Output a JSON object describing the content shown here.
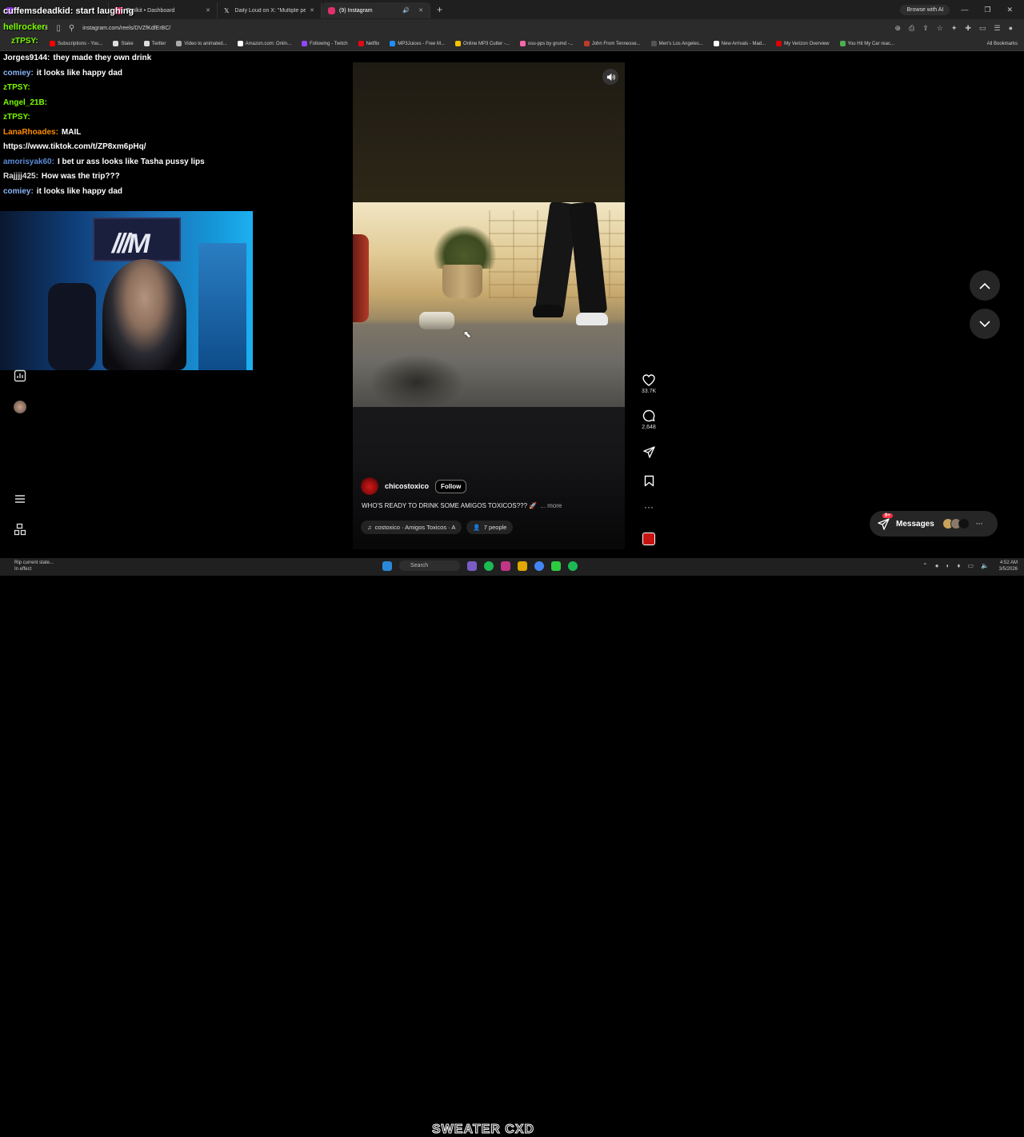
{
  "browser": {
    "tabs": [
      {
        "title": "",
        "active": false,
        "color": "#8a2be2"
      },
      {
        "title": "Toolkit • Dashboard",
        "active": false,
        "color": "#e91e63"
      },
      {
        "title": "Daily Loud on X: \"Multiple peo",
        "active": false,
        "color": "#ffffff"
      },
      {
        "title": "(9) Instagram",
        "active": true,
        "color": "#e1306c"
      }
    ],
    "browse_ai": "Browse with AI",
    "url": "instagram.com/reels/DVZfKdfErBC/",
    "bookmarks": [
      {
        "label": "Subscriptions - You...",
        "color": "#ff0000"
      },
      {
        "label": "Stake",
        "color": "#dddddd"
      },
      {
        "label": "Twitter",
        "color": "#dddddd"
      },
      {
        "label": "Video to animated...",
        "color": "#aaaaaa"
      },
      {
        "label": "Amazon.com: Onlin...",
        "color": "#ffffff"
      },
      {
        "label": "Following - Twitch",
        "color": "#9146ff"
      },
      {
        "label": "Netflix",
        "color": "#e50914"
      },
      {
        "label": "MP3Juices - Free M...",
        "color": "#1e90ff"
      },
      {
        "label": "Online MP3 Cutter -...",
        "color": "#f5c400"
      },
      {
        "label": "osu-pps by grumd -...",
        "color": "#ff66aa"
      },
      {
        "label": "John From Tennesse...",
        "color": "#c0392b"
      },
      {
        "label": "Men's Los Angeles...",
        "color": "#555555"
      },
      {
        "label": "New Arrivals - Mad...",
        "color": "#ffffff"
      },
      {
        "label": "My Verizon Overview",
        "color": "#e00000"
      },
      {
        "label": "You Hit My Car reac...",
        "color": "#4caf50"
      }
    ],
    "all_bookmarks": "All Bookmarks"
  },
  "chat": {
    "overlay_top": {
      "user": "cuffemsdeadkid:",
      "text": "start laughing",
      "user_color": "#ffffff"
    },
    "overlay_second": {
      "user": "hellrocker:",
      "text": "",
      "user_color": "#7CFC00"
    },
    "overlay_third": {
      "user": "zTPSY:",
      "text": "",
      "user_color": "#7CFC00"
    },
    "messages": [
      {
        "user": "Jorges9144:",
        "text": "they made they own drink",
        "user_color": "#ffffff"
      },
      {
        "user": "comiey:",
        "text": "it looks like happy dad",
        "user_color": "#8ab4f8"
      },
      {
        "user": "zTPSY:",
        "text": "",
        "user_color": "#7CFC00"
      },
      {
        "user": "Angel_21B:",
        "text": "",
        "user_color": "#7CFC00"
      },
      {
        "user": "zTPSY:",
        "text": "",
        "user_color": "#7CFC00"
      },
      {
        "user": "LanaRhoades:",
        "text": "MAIL",
        "user_color": "#ff8c00"
      },
      {
        "user": "",
        "text": "https://www.tiktok.com/t/ZP8xm6pHq/",
        "user_color": "#ffffff"
      },
      {
        "user": "amorisyak60:",
        "text": "I bet ur ass looks like Tasha pussy lips",
        "user_color": "#5c8bd6"
      },
      {
        "user": "Rajjjj425:",
        "text": "How was the trip???",
        "user_color": "#dddddd"
      },
      {
        "user": "comiey:",
        "text": "it looks like happy dad",
        "user_color": "#8ab4f8"
      }
    ]
  },
  "reel": {
    "author": "chicostoxico",
    "follow_label": "Follow",
    "caption": "WHO'S READY TO DRINK SOME AMIGOS TOXICOS??? 🚀",
    "more_label": "... more",
    "audio": "costoxico · Amigos Toxicos · A",
    "people": "7 people",
    "likes": "33.7K",
    "comments": "2,648"
  },
  "messages_bar": {
    "label": "Messages",
    "badge": "9+"
  },
  "taskbar": {
    "left_line1": "Rip current state...",
    "left_line2": "In effect",
    "search": "Search",
    "time": "4:52 AM",
    "date": "3/5/2026",
    "overlay_text": "SWEATER CXD"
  }
}
